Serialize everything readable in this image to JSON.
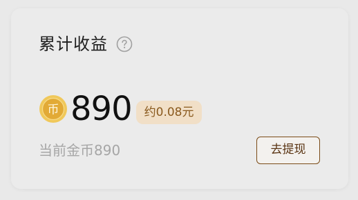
{
  "card": {
    "title": "累计收益",
    "help_icon": "question-circle-icon",
    "coin_icon": "coin-icon",
    "coin_glyph": "币",
    "amount": "890",
    "approx_value": "约0.08元",
    "balance_text": "当前金币890",
    "withdraw_label": "去提现"
  },
  "colors": {
    "accent_brown": "#7a4a16",
    "badge_bg": "#f1dfc7",
    "coin_gold": "#e6b94a"
  }
}
